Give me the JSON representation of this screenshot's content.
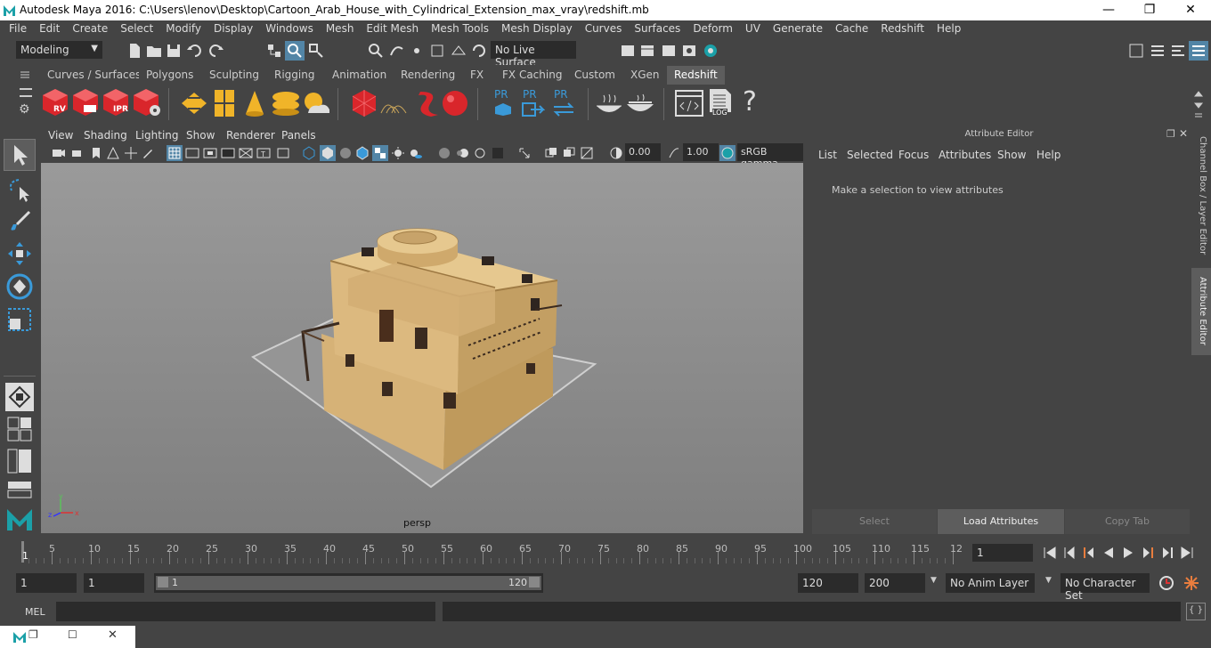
{
  "window": {
    "title": "Autodesk Maya 2016: C:\\Users\\lenov\\Desktop\\Cartoon_Arab_House_with_Cylindrical_Extension_max_vray\\redshift.mb"
  },
  "menu": [
    "File",
    "Edit",
    "Create",
    "Select",
    "Modify",
    "Display",
    "Windows",
    "Mesh",
    "Edit Mesh",
    "Mesh Tools",
    "Mesh Display",
    "Curves",
    "Surfaces",
    "Deform",
    "UV",
    "Generate",
    "Cache",
    "Redshift",
    "Help"
  ],
  "status": {
    "mode": "Modeling",
    "live_surface": "No Live Surface"
  },
  "shelf_tabs": [
    {
      "label": "Curves / Surfaces"
    },
    {
      "label": "Polygons"
    },
    {
      "label": "Sculpting"
    },
    {
      "label": "Rigging"
    },
    {
      "label": "Animation"
    },
    {
      "label": "Rendering"
    },
    {
      "label": "FX"
    },
    {
      "label": "FX Caching"
    },
    {
      "label": "Custom"
    },
    {
      "label": "XGen"
    },
    {
      "label": "Redshift"
    }
  ],
  "shelf_active": "Redshift",
  "shelf_icons": {
    "rv": "RV",
    "ipr": "IPR",
    "pr": "PR",
    "log": "LOG",
    "help": "?"
  },
  "viewport": {
    "menu": [
      "View",
      "Shading",
      "Lighting",
      "Show",
      "Renderer",
      "Panels"
    ],
    "exposure": "0.00",
    "gamma": "1.00",
    "colorspace": "sRGB gamma",
    "camera": "persp"
  },
  "attribute_editor": {
    "title": "Attribute Editor",
    "menu": [
      "List",
      "Selected",
      "Focus",
      "Attributes",
      "Show",
      "Help"
    ],
    "message": "Make a selection to view attributes",
    "buttons": {
      "select": "Select",
      "load": "Load Attributes",
      "copy": "Copy Tab"
    }
  },
  "side_tabs": {
    "channel_box": "Channel Box / Layer Editor",
    "attribute_editor": "Attribute Editor"
  },
  "timeline": {
    "ticks": [
      "5",
      "10",
      "15",
      "20",
      "25",
      "30",
      "35",
      "40",
      "45",
      "50",
      "55",
      "60",
      "65",
      "70",
      "75",
      "80",
      "85",
      "90",
      "95",
      "100",
      "105",
      "110",
      "115",
      "12"
    ],
    "start_marker": "1",
    "current_frame": "1"
  },
  "range": {
    "start": "1",
    "playback_start": "1",
    "slider_start": "1",
    "slider_end": "120",
    "playback_end": "120",
    "end": "200",
    "anim_layer": "No Anim Layer",
    "character_set": "No Character Set"
  },
  "mel": {
    "label": "MEL"
  },
  "colors": {
    "accent": "#5285a6",
    "maya_teal": "#1ba0a8",
    "redshift_red": "#d9262b"
  }
}
